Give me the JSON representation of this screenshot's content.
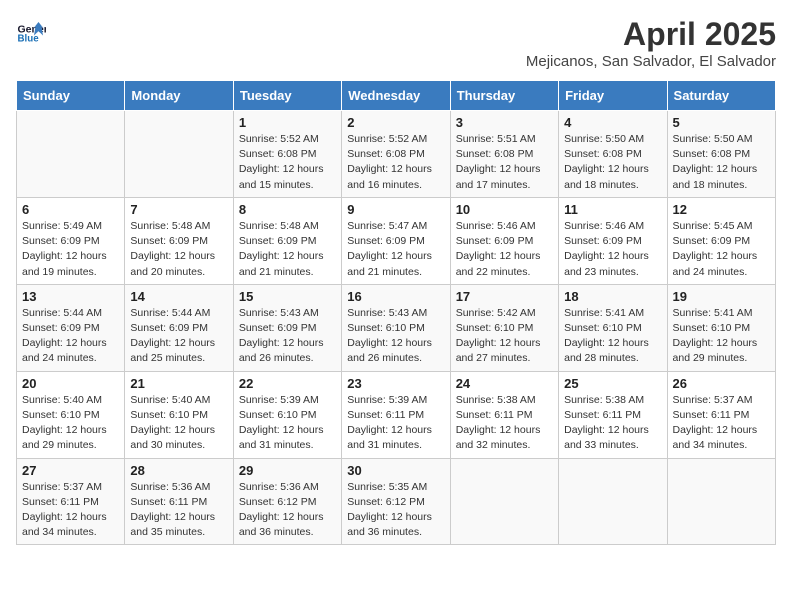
{
  "header": {
    "logo_line1": "General",
    "logo_line2": "Blue",
    "month_title": "April 2025",
    "location": "Mejicanos, San Salvador, El Salvador"
  },
  "weekdays": [
    "Sunday",
    "Monday",
    "Tuesday",
    "Wednesday",
    "Thursday",
    "Friday",
    "Saturday"
  ],
  "weeks": [
    [
      {
        "day": "",
        "info": ""
      },
      {
        "day": "",
        "info": ""
      },
      {
        "day": "1",
        "info": "Sunrise: 5:52 AM\nSunset: 6:08 PM\nDaylight: 12 hours and 15 minutes."
      },
      {
        "day": "2",
        "info": "Sunrise: 5:52 AM\nSunset: 6:08 PM\nDaylight: 12 hours and 16 minutes."
      },
      {
        "day": "3",
        "info": "Sunrise: 5:51 AM\nSunset: 6:08 PM\nDaylight: 12 hours and 17 minutes."
      },
      {
        "day": "4",
        "info": "Sunrise: 5:50 AM\nSunset: 6:08 PM\nDaylight: 12 hours and 18 minutes."
      },
      {
        "day": "5",
        "info": "Sunrise: 5:50 AM\nSunset: 6:08 PM\nDaylight: 12 hours and 18 minutes."
      }
    ],
    [
      {
        "day": "6",
        "info": "Sunrise: 5:49 AM\nSunset: 6:09 PM\nDaylight: 12 hours and 19 minutes."
      },
      {
        "day": "7",
        "info": "Sunrise: 5:48 AM\nSunset: 6:09 PM\nDaylight: 12 hours and 20 minutes."
      },
      {
        "day": "8",
        "info": "Sunrise: 5:48 AM\nSunset: 6:09 PM\nDaylight: 12 hours and 21 minutes."
      },
      {
        "day": "9",
        "info": "Sunrise: 5:47 AM\nSunset: 6:09 PM\nDaylight: 12 hours and 21 minutes."
      },
      {
        "day": "10",
        "info": "Sunrise: 5:46 AM\nSunset: 6:09 PM\nDaylight: 12 hours and 22 minutes."
      },
      {
        "day": "11",
        "info": "Sunrise: 5:46 AM\nSunset: 6:09 PM\nDaylight: 12 hours and 23 minutes."
      },
      {
        "day": "12",
        "info": "Sunrise: 5:45 AM\nSunset: 6:09 PM\nDaylight: 12 hours and 24 minutes."
      }
    ],
    [
      {
        "day": "13",
        "info": "Sunrise: 5:44 AM\nSunset: 6:09 PM\nDaylight: 12 hours and 24 minutes."
      },
      {
        "day": "14",
        "info": "Sunrise: 5:44 AM\nSunset: 6:09 PM\nDaylight: 12 hours and 25 minutes."
      },
      {
        "day": "15",
        "info": "Sunrise: 5:43 AM\nSunset: 6:09 PM\nDaylight: 12 hours and 26 minutes."
      },
      {
        "day": "16",
        "info": "Sunrise: 5:43 AM\nSunset: 6:10 PM\nDaylight: 12 hours and 26 minutes."
      },
      {
        "day": "17",
        "info": "Sunrise: 5:42 AM\nSunset: 6:10 PM\nDaylight: 12 hours and 27 minutes."
      },
      {
        "day": "18",
        "info": "Sunrise: 5:41 AM\nSunset: 6:10 PM\nDaylight: 12 hours and 28 minutes."
      },
      {
        "day": "19",
        "info": "Sunrise: 5:41 AM\nSunset: 6:10 PM\nDaylight: 12 hours and 29 minutes."
      }
    ],
    [
      {
        "day": "20",
        "info": "Sunrise: 5:40 AM\nSunset: 6:10 PM\nDaylight: 12 hours and 29 minutes."
      },
      {
        "day": "21",
        "info": "Sunrise: 5:40 AM\nSunset: 6:10 PM\nDaylight: 12 hours and 30 minutes."
      },
      {
        "day": "22",
        "info": "Sunrise: 5:39 AM\nSunset: 6:10 PM\nDaylight: 12 hours and 31 minutes."
      },
      {
        "day": "23",
        "info": "Sunrise: 5:39 AM\nSunset: 6:11 PM\nDaylight: 12 hours and 31 minutes."
      },
      {
        "day": "24",
        "info": "Sunrise: 5:38 AM\nSunset: 6:11 PM\nDaylight: 12 hours and 32 minutes."
      },
      {
        "day": "25",
        "info": "Sunrise: 5:38 AM\nSunset: 6:11 PM\nDaylight: 12 hours and 33 minutes."
      },
      {
        "day": "26",
        "info": "Sunrise: 5:37 AM\nSunset: 6:11 PM\nDaylight: 12 hours and 34 minutes."
      }
    ],
    [
      {
        "day": "27",
        "info": "Sunrise: 5:37 AM\nSunset: 6:11 PM\nDaylight: 12 hours and 34 minutes."
      },
      {
        "day": "28",
        "info": "Sunrise: 5:36 AM\nSunset: 6:11 PM\nDaylight: 12 hours and 35 minutes."
      },
      {
        "day": "29",
        "info": "Sunrise: 5:36 AM\nSunset: 6:12 PM\nDaylight: 12 hours and 36 minutes."
      },
      {
        "day": "30",
        "info": "Sunrise: 5:35 AM\nSunset: 6:12 PM\nDaylight: 12 hours and 36 minutes."
      },
      {
        "day": "",
        "info": ""
      },
      {
        "day": "",
        "info": ""
      },
      {
        "day": "",
        "info": ""
      }
    ]
  ]
}
